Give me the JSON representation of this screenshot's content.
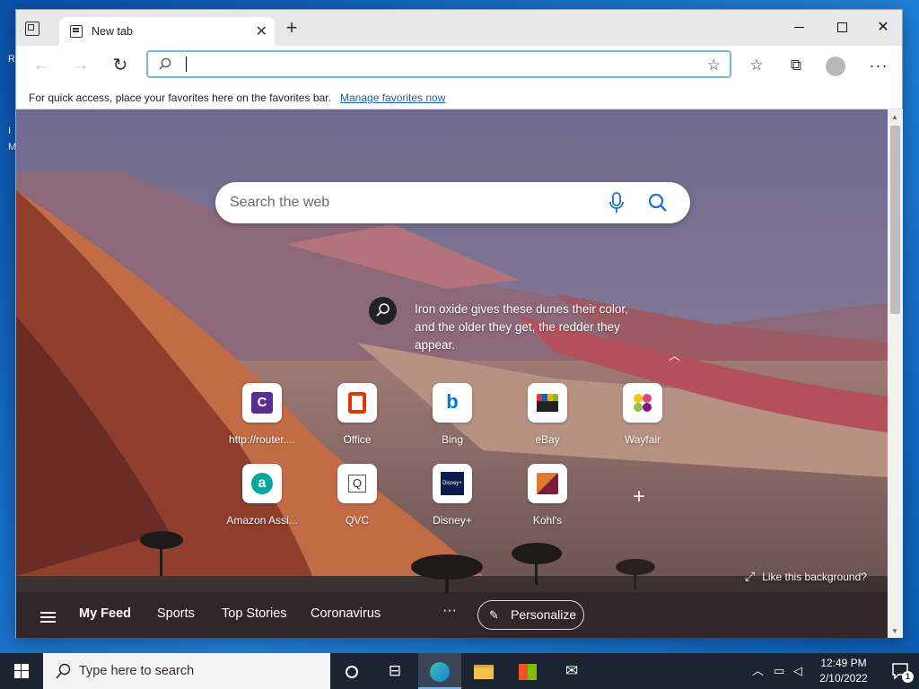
{
  "desktop": {
    "fragments": [
      "R",
      "I",
      "M"
    ]
  },
  "browser": {
    "tab": {
      "title": "New tab"
    },
    "address": {
      "value": "",
      "placeholder": ""
    },
    "favorites_bar": {
      "text": "For quick access, place your favorites here on the favorites bar.",
      "link": "Manage favorites now"
    }
  },
  "new_tab_page": {
    "search": {
      "placeholder": "Search the web"
    },
    "background_info": "Iron oxide gives these dunes their color, and the older they get, the redder they appear.",
    "quick_links": [
      {
        "label": "http://router....",
        "letter": "C",
        "color": "#5c2d91"
      },
      {
        "label": "Office",
        "letter": "O",
        "color": "#d83b01"
      },
      {
        "label": "Bing",
        "letter": "b",
        "color": "#0078d4"
      },
      {
        "label": "eBay",
        "letter": "",
        "color": "#222222"
      },
      {
        "label": "Wayfair",
        "letter": "",
        "color": "#7f187f"
      },
      {
        "label": "Amazon Assi...",
        "letter": "a",
        "color": "#00a8a0"
      },
      {
        "label": "QVC",
        "letter": "Q",
        "color": "#444444"
      },
      {
        "label": "Disney+",
        "letter": "Disney+",
        "color": "#0b1b4d"
      },
      {
        "label": "Kohl's",
        "letter": "",
        "color": "#7b1e3b"
      }
    ],
    "like_background": "Like this background?",
    "feed_tabs": [
      "My Feed",
      "Sports",
      "Top Stories",
      "Coronavirus"
    ],
    "more": "···",
    "personalize": "Personalize"
  },
  "taskbar": {
    "search_text": "Type here to search",
    "time": "12:49 PM",
    "date": "2/10/2022",
    "notifications": "1"
  }
}
